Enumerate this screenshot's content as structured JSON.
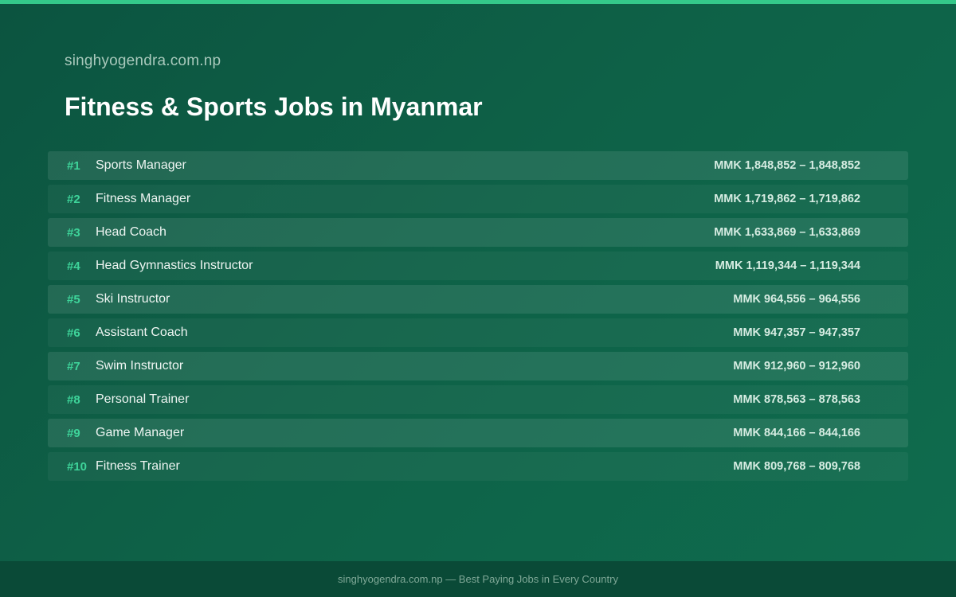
{
  "header": {
    "site_name": "singhyogendra.com.np",
    "title": "Fitness & Sports Jobs in Myanmar"
  },
  "jobs": [
    {
      "rank": "#1",
      "title": "Sports Manager",
      "salary": "MMK 1,848,852 – 1,848,852"
    },
    {
      "rank": "#2",
      "title": "Fitness Manager",
      "salary": "MMK 1,719,862 – 1,719,862"
    },
    {
      "rank": "#3",
      "title": "Head Coach",
      "salary": "MMK 1,633,869 – 1,633,869"
    },
    {
      "rank": "#4",
      "title": "Head Gymnastics Instructor",
      "salary": "MMK 1,119,344 – 1,119,344"
    },
    {
      "rank": "#5",
      "title": "Ski Instructor",
      "salary": "MMK 964,556 – 964,556"
    },
    {
      "rank": "#6",
      "title": "Assistant Coach",
      "salary": "MMK 947,357 – 947,357"
    },
    {
      "rank": "#7",
      "title": "Swim Instructor",
      "salary": "MMK 912,960 – 912,960"
    },
    {
      "rank": "#8",
      "title": "Personal Trainer",
      "salary": "MMK 878,563 – 878,563"
    },
    {
      "rank": "#9",
      "title": "Game Manager",
      "salary": "MMK 844,166 – 844,166"
    },
    {
      "rank": "#10",
      "title": "Fitness Trainer",
      "salary": "MMK 809,768 – 809,768"
    }
  ],
  "footer": {
    "text": "singhyogendra.com.np — Best Paying Jobs in Every Country"
  },
  "colors": {
    "background": "#0e6147",
    "accent": "#34c98a",
    "rank": "#3ed49a",
    "footer_background": "#0a4a37"
  }
}
